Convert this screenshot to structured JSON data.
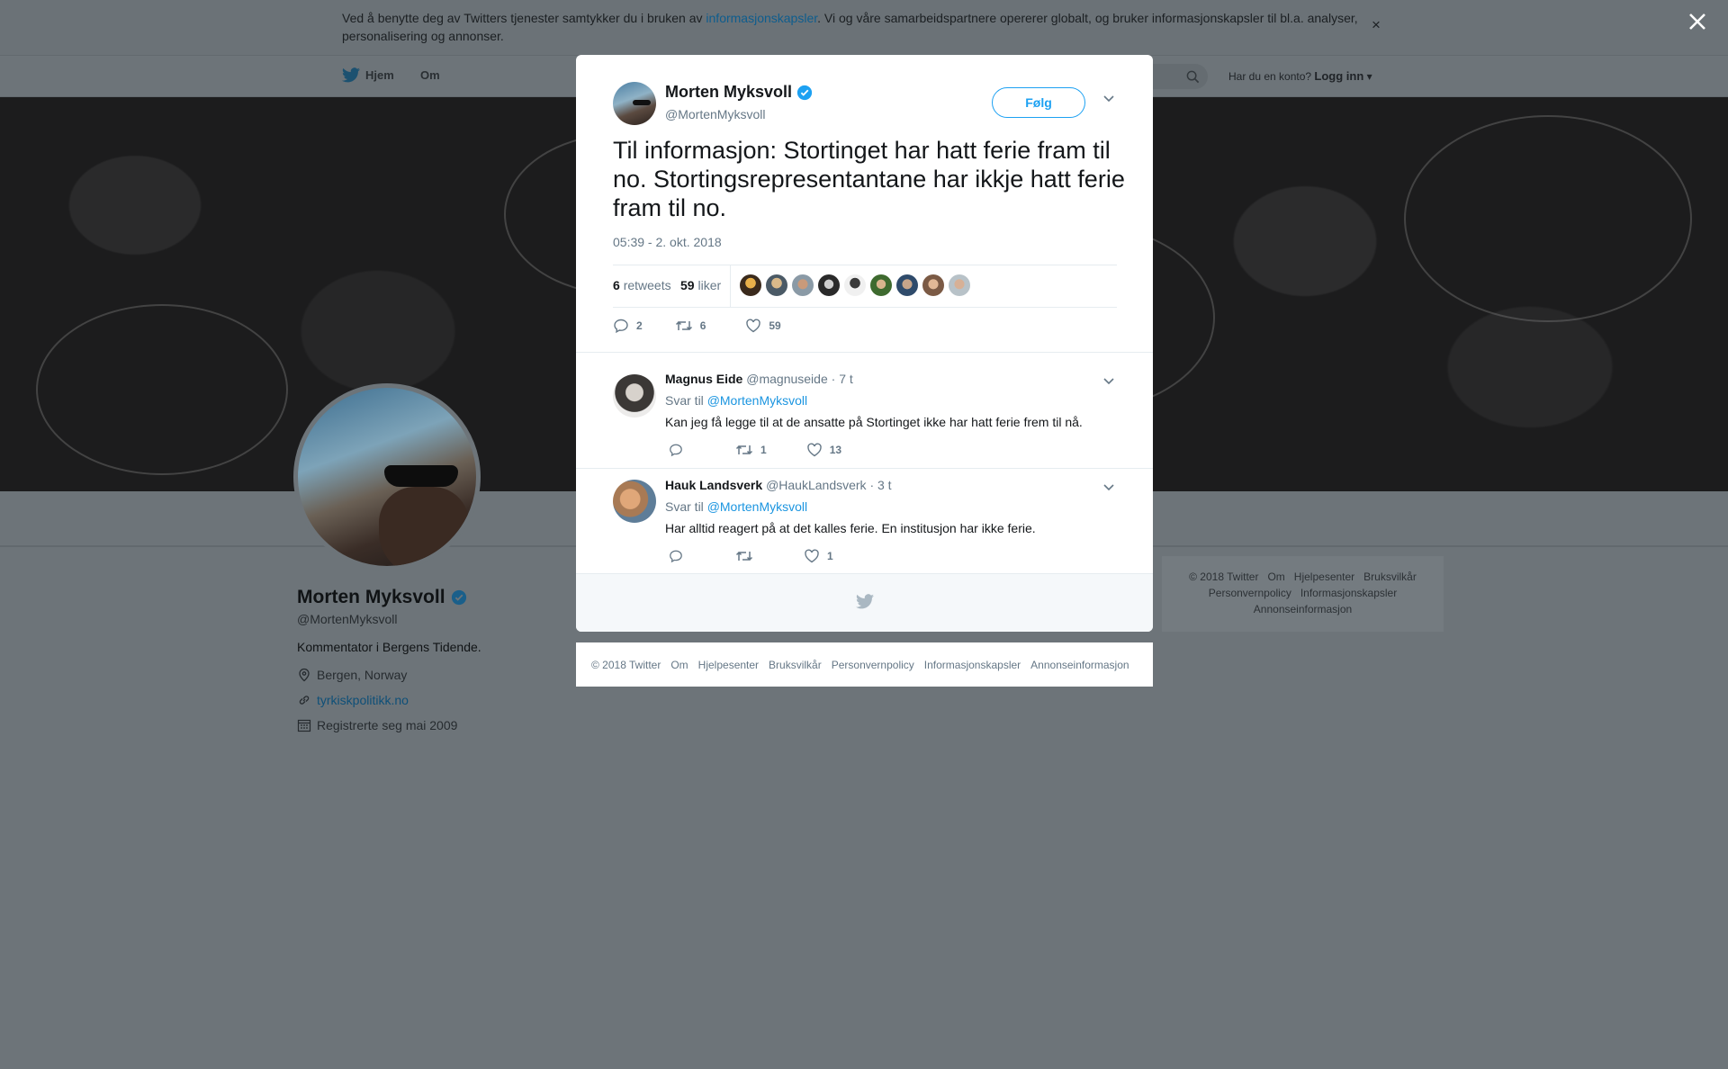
{
  "cookie": {
    "text_before": "Ved å benytte deg av Twitters tjenester samtykker du i bruken av ",
    "link": "informasjonskapsler",
    "text_after": ". Vi og våre samarbeidspartnere opererer globalt, og bruker informasjonskapsler til bl.a. analyser, personalisering og annonser."
  },
  "nav": {
    "home": "Hjem",
    "about": "Om",
    "login_prompt": "Har du en konto?",
    "login": "Logg inn"
  },
  "profile": {
    "name": "Morten Myksvoll",
    "handle": "@MortenMyksvoll",
    "bio": "Kommentator i Bergens Tidende.",
    "location": "Bergen, Norway",
    "website": "tyrkiskpolitikk.no",
    "joined": "Registrerte seg mai 2009"
  },
  "side_footer": {
    "links": [
      "© 2018 Twitter",
      "Om",
      "Hjelpesenter",
      "Bruksvilkår",
      "Personvernpolicy",
      "Informasjonskapsler",
      "Annonseinformasjon"
    ]
  },
  "tweet": {
    "name": "Morten Myksvoll",
    "handle": "@MortenMyksvoll",
    "follow": "Følg",
    "text": "Til informasjon: Stortinget har hatt ferie fram til no. Stortingsrepresentantane har ikkje hatt ferie fram til no.",
    "time": "05:39 - 2. okt. 2018",
    "retweets_count": "6",
    "retweets_label": "retweets",
    "likes_count": "59",
    "likes_label": "liker",
    "actions": {
      "replies": "2",
      "retweets": "6",
      "likes": "59"
    }
  },
  "replies": [
    {
      "name": "Magnus Eide",
      "handle": "@magnuseide",
      "time": "· 7 t",
      "reply_to_label": "Svar til",
      "reply_to": "@MortenMyksvoll",
      "text": "Kan jeg få legge til at de ansatte på Stortinget ikke har hatt ferie frem til nå.",
      "retweets": "1",
      "likes": "13"
    },
    {
      "name": "Hauk Landsverk",
      "handle": "@HaukLandsverk",
      "time": "· 3 t",
      "reply_to_label": "Svar til",
      "reply_to": "@MortenMyksvoll",
      "text": "Har alltid reagert på at det kalles ferie. En institusjon har ikke ferie.",
      "retweets": "",
      "likes": "1"
    }
  ],
  "modal_footer": {
    "links": [
      "© 2018 Twitter",
      "Om",
      "Hjelpesenter",
      "Bruksvilkår",
      "Personvernpolicy",
      "Informasjonskapsler",
      "Annonseinformasjon"
    ]
  },
  "colors": {
    "accent": "#1da1f2",
    "link": "#1b95e0",
    "muted": "#657786",
    "overlay": "#6d7479"
  },
  "icons": [
    "twitter-bird-icon",
    "search-icon",
    "verified-icon",
    "chevron-down-icon",
    "reply-icon",
    "retweet-icon",
    "heart-icon",
    "location-icon",
    "link-icon",
    "calendar-icon",
    "close-icon"
  ]
}
